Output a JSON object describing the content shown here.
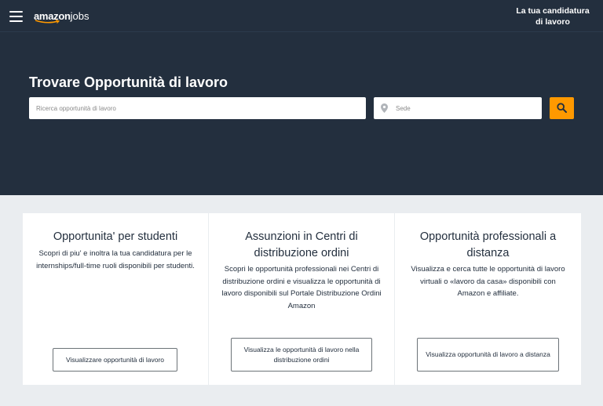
{
  "header": {
    "menu_icon": "hamburger-menu-icon",
    "logo": {
      "part1": "amazon",
      "part2": "jobs"
    },
    "application_link": "La tua candidatura di lavoro"
  },
  "hero": {
    "title": "Trovare Opportunità di lavoro",
    "search": {
      "placeholder": "Ricerca opportunità di lavoro",
      "value": ""
    },
    "location": {
      "placeholder": "Sede",
      "value": "",
      "icon": "map-pin-icon"
    },
    "search_button_icon": "search-icon"
  },
  "cards": [
    {
      "title": "Opportunita' per studenti",
      "description": "Scopri di piu' e inoltra la tua candidatura per le internships/full-time ruoli disponibili per studenti.",
      "button": "Visualizzare opportunità di lavoro"
    },
    {
      "title": "Assunzioni in Centri di distribuzione ordini",
      "description": "Scopri le opportunità professionali nei Centri di distribuzione ordini e visualizza le opportunità di lavoro disponibili sul Portale Distribuzione Ordini Amazon",
      "button": "Visualizza le opportunità di lavoro nella distribuzione ordini"
    },
    {
      "title": "Opportunità professionali a distanza",
      "description": "Visualizza e cerca tutte le opportunità di lavoro virtuali o «lavoro da casa» disponibili con Amazon e affiliate.",
      "button": "Visualizza opportunità di lavoro a distanza"
    }
  ],
  "colors": {
    "navy": "#232f3e",
    "accent_orange": "#ff9900",
    "section_background": "#eaedf0"
  }
}
